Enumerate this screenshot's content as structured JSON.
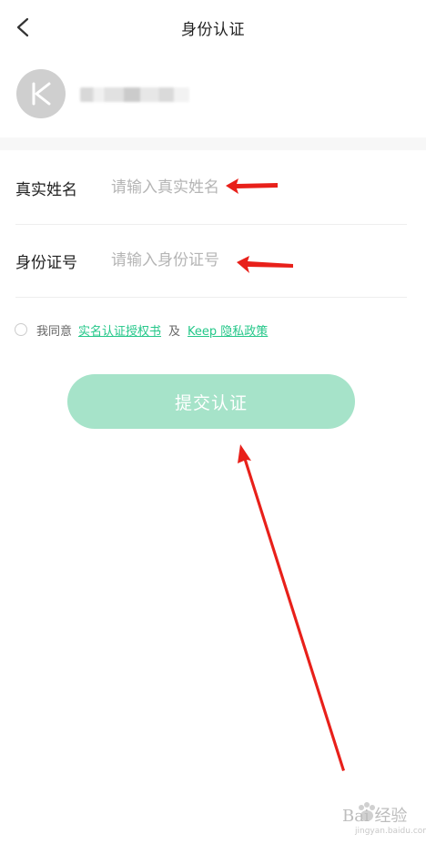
{
  "header": {
    "title": "身份认证",
    "back_icon": "chevron-left-icon"
  },
  "user": {
    "avatar_letter": "K",
    "avatar_color": "#cfcfcf"
  },
  "form": {
    "name_label": "真实姓名",
    "name_placeholder": "请输入真实姓名",
    "id_label": "身份证号",
    "id_placeholder": "请输入身份证号"
  },
  "agreement": {
    "prefix": "我同意",
    "auth_link": "实名认证授权书",
    "and": "及",
    "privacy_link": "Keep 隐私政策"
  },
  "submit": {
    "label": "提交认证"
  },
  "watermark": {
    "text": "Bai 经验",
    "sub": "jingyan.baidu.com"
  },
  "colors": {
    "accent": "#24c789",
    "button_disabled": "#a6e3c9",
    "annotation_arrow": "#e8201a"
  }
}
